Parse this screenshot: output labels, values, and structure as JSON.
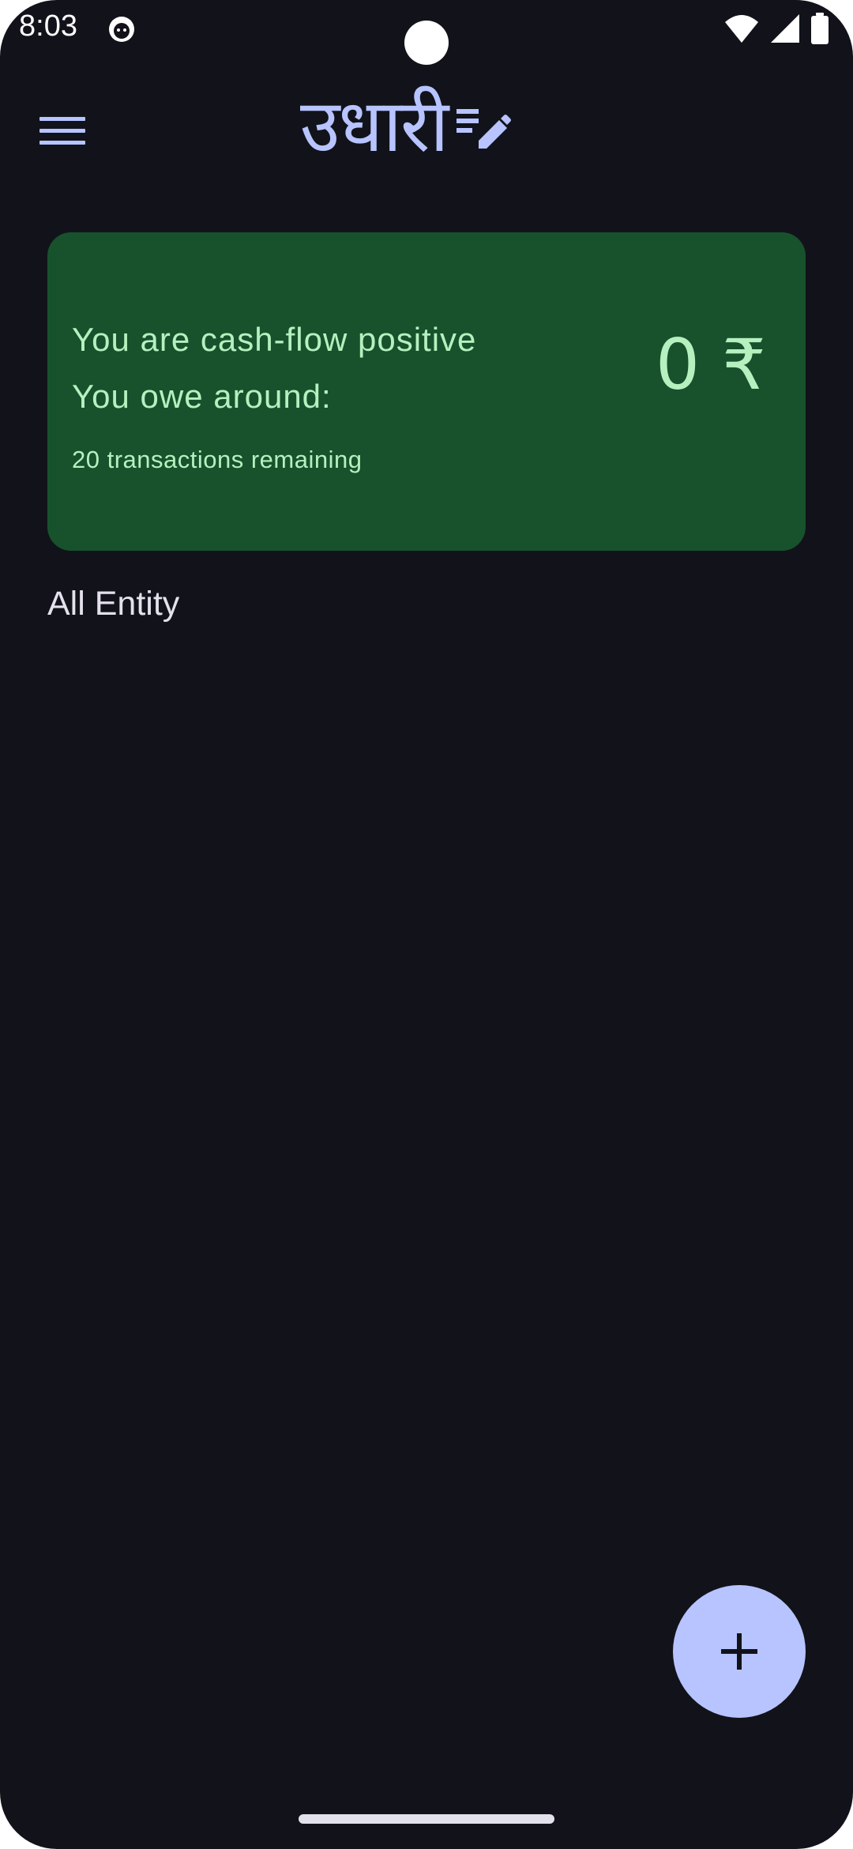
{
  "status_bar": {
    "time": "8:03",
    "icons": [
      "app-notification-icon",
      "wifi-icon",
      "cellular-signal-icon",
      "battery-icon"
    ]
  },
  "app_bar": {
    "menu_icon": "hamburger-menu-icon",
    "title": "उधारी",
    "title_icon": "edit-note-icon"
  },
  "summary_card": {
    "status_text": "You are cash-flow positive",
    "owe_label": "You owe around:",
    "remaining_text": "20 transactions remaining",
    "amount": "0 ₹"
  },
  "section": {
    "title": "All Entity"
  },
  "fab": {
    "icon": "add-icon"
  },
  "colors": {
    "background": "#12131a",
    "accent": "#b7c4ff",
    "card_background": "#17522d",
    "card_text": "#b6f0bf",
    "text": "#e3e2ec"
  }
}
